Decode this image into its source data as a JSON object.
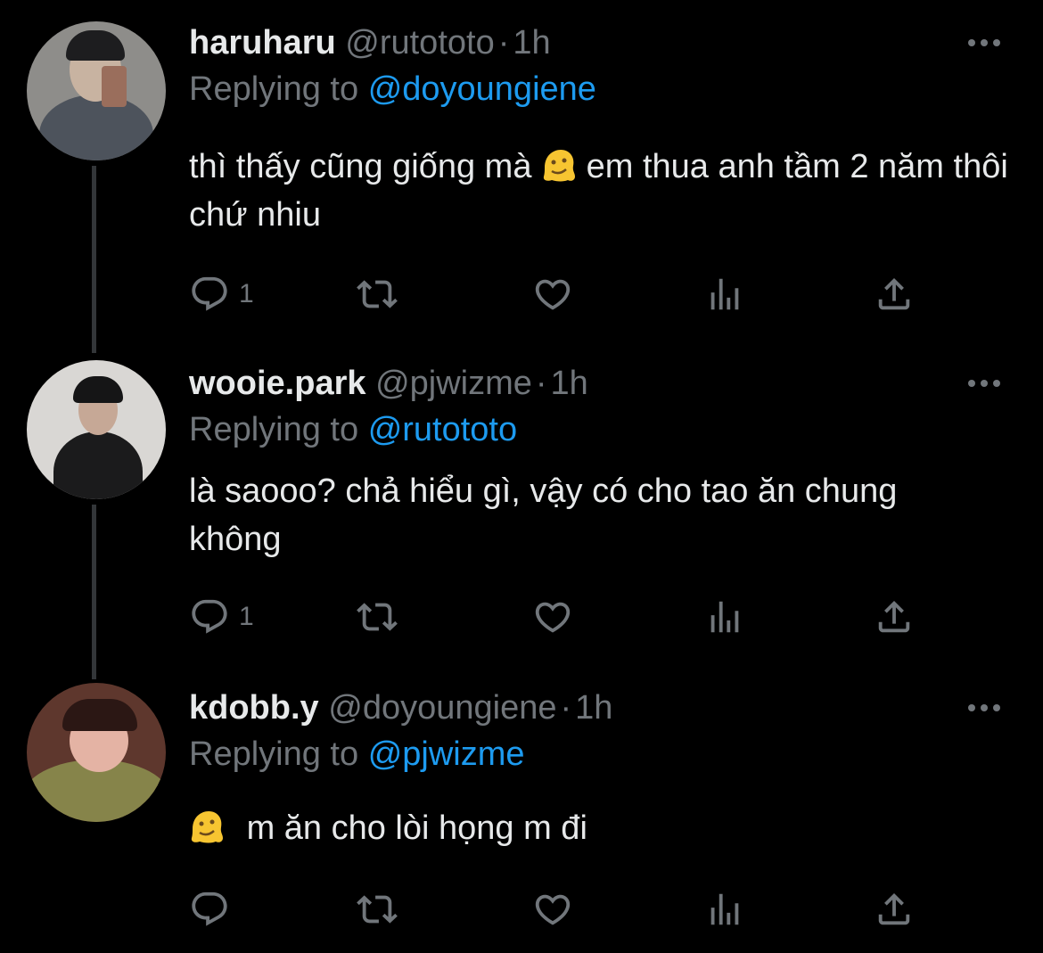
{
  "tweets": [
    {
      "name": "haruharu",
      "handle": "@rutototo",
      "dot": "·",
      "time": "1h",
      "replying_prefix": "Replying to",
      "replying_to": "@doyoungiene",
      "text_before": "thì thấy cũng giống mà",
      "emoji": "melting-face-emoji",
      "text_after": "em thua anh tầm 2 năm thôi chứ nhiu",
      "reply_count": "1",
      "avatar_colors": {
        "bg": "#9a9a98",
        "face": "#c9b4a2",
        "body": "#4a4f57"
      }
    },
    {
      "name": "wooie.park",
      "handle": "@pjwizme",
      "dot": "·",
      "time": "1h",
      "replying_prefix": "Replying to",
      "replying_to": "@rutototo",
      "text_before": "là saooo? chả hiểu gì, vậy có cho tao ăn chung không",
      "emoji": "",
      "text_after": "",
      "reply_count": "1",
      "avatar_colors": {
        "bg": "#d8d6d3",
        "face": "#c7aa98",
        "body": "#1a1a1a"
      }
    },
    {
      "name": "kdobb.y",
      "handle": "@doyoungiene",
      "dot": "·",
      "time": "1h",
      "replying_prefix": "Replying to",
      "replying_to": "@pjwizme",
      "text_before": "",
      "emoji": "melting-face-emoji",
      "text_after": "m ăn cho lòi họng m đi",
      "reply_count": "",
      "avatar_colors": {
        "bg": "#6b4034",
        "face": "#e6b6a8",
        "body": "#8c8a4a"
      }
    }
  ],
  "icons": [
    "reply-icon",
    "retweet-icon",
    "like-icon",
    "views-icon",
    "share-icon",
    "more-icon"
  ],
  "colors": {
    "background": "#000000",
    "text": "#e7e9ea",
    "muted": "#71767b",
    "link": "#1d9bf0",
    "thread_line": "#333639"
  }
}
